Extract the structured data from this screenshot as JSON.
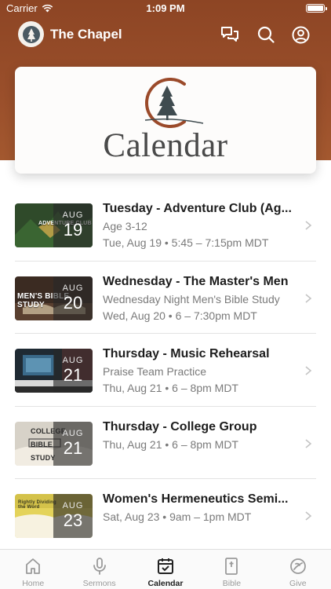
{
  "status_bar": {
    "carrier": "Carrier",
    "time": "1:09 PM"
  },
  "header": {
    "app_title": "The Chapel"
  },
  "banner": {
    "word": "Calendar"
  },
  "events": [
    {
      "title": "Tuesday - Adventure Club (Ag...",
      "subtitle": "Age 3-12",
      "when": "Tue, Aug 19 • 5:45 – 7:15pm MDT",
      "month": "AUG",
      "day": "19",
      "thumb_text": "ADVENTURE CLUB"
    },
    {
      "title": "Wednesday - The Master's Men",
      "subtitle": "Wednesday Night Men's Bible Study",
      "when": "Wed, Aug 20 • 6 – 7:30pm MDT",
      "month": "AUG",
      "day": "20",
      "thumb_text": "MEN'S BIBLE STUDY"
    },
    {
      "title": "Thursday - Music Rehearsal",
      "subtitle": "Praise Team Practice",
      "when": "Thu, Aug 21 • 6 – 8pm MDT",
      "month": "AUG",
      "day": "21",
      "thumb_text": ""
    },
    {
      "title": "Thursday - College Group",
      "subtitle": "",
      "when": "Thu, Aug 21 • 6 – 8pm MDT",
      "month": "AUG",
      "day": "21",
      "thumb_text": "COLLEGE BIBLE STUDY"
    },
    {
      "title": "Women's Hermeneutics Semi...",
      "subtitle": "",
      "when": "Sat, Aug 23 • 9am – 1pm MDT",
      "month": "AUG",
      "day": "23",
      "thumb_text": "Rightly Dividing the Word"
    }
  ],
  "tabs": [
    {
      "label": "Home",
      "icon": "home-icon",
      "active": false
    },
    {
      "label": "Sermons",
      "icon": "microphone-icon",
      "active": false
    },
    {
      "label": "Calendar",
      "icon": "calendar-icon",
      "active": true
    },
    {
      "label": "Bible",
      "icon": "bible-icon",
      "active": false
    },
    {
      "label": "Give",
      "icon": "give-icon",
      "active": false
    }
  ],
  "colors": {
    "header_brown": "#9a4f2b",
    "emblem_rust": "#9b4a2a",
    "tab_active": "#222222",
    "tab_inactive": "#9a9a9a"
  }
}
